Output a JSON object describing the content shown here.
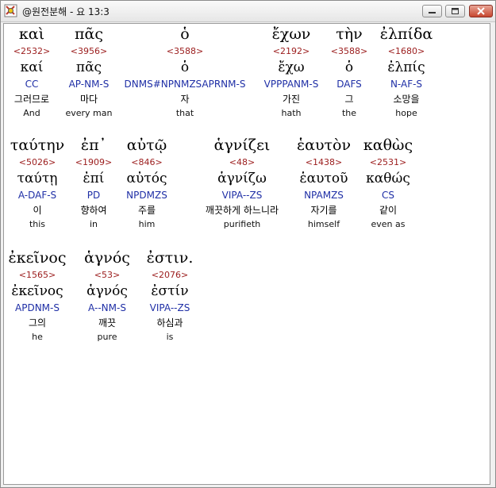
{
  "window": {
    "title": "@원전분해 - 요 13:3"
  },
  "rows": [
    {
      "words": [
        {
          "greek": "καὶ",
          "strong": "<2532>",
          "lemma": "καί",
          "parse": "CC",
          "korean": "그러므로",
          "english": "And"
        },
        {
          "greek": "πᾶς",
          "strong": "<3956>",
          "lemma": "πᾶς",
          "parse": "AP-NM-S",
          "korean": "마다",
          "english": "every man"
        },
        {
          "greek": "ὁ",
          "strong": "<3588>",
          "lemma": "ὁ",
          "parse": "DNMS#NPNMZSAPRNM-S",
          "korean": "자",
          "english": "that"
        },
        {
          "greek": "ἔχων",
          "strong": "<2192>",
          "lemma": "ἔχω",
          "parse": "VPPPANM-S",
          "korean": "가진",
          "english": "hath"
        },
        {
          "greek": "τὴν",
          "strong": "<3588>",
          "lemma": "ὁ",
          "parse": "DAFS",
          "korean": "그",
          "english": "the"
        },
        {
          "greek": "ἐλπίδα",
          "strong": "<1680>",
          "lemma": "ἐλπίς",
          "parse": "N-AF-S",
          "korean": "소망을",
          "english": "hope"
        }
      ]
    },
    {
      "words": [
        {
          "greek": "ταύτην",
          "strong": "<5026>",
          "lemma": "ταύτῃ",
          "parse": "A-DAF-S",
          "korean": "이",
          "english": "this"
        },
        {
          "greek": "ἐπ᾽",
          "strong": "<1909>",
          "lemma": "ἐπί",
          "parse": "PD",
          "korean": "향하여",
          "english": "in"
        },
        {
          "greek": "αὐτῷ",
          "strong": "<846>",
          "lemma": "αὐτός",
          "parse": "NPDMZS",
          "korean": "주를",
          "english": "him"
        },
        {
          "greek": "ἁγνίζει",
          "strong": "<48>",
          "lemma": "ἁγνίζω",
          "parse": "VIPA--ZS",
          "korean": "깨끗하게 하느니라",
          "english": "purifieth"
        },
        {
          "greek": "ἑαυτὸν",
          "strong": "<1438>",
          "lemma": "ἑαυτοῦ",
          "parse": "NPAMZS",
          "korean": "자기를",
          "english": "himself"
        },
        {
          "greek": "καθὼς",
          "strong": "<2531>",
          "lemma": "καθώς",
          "parse": "CS",
          "korean": "같이",
          "english": "even as"
        }
      ]
    },
    {
      "words": [
        {
          "greek": "ἐκεῖνος",
          "strong": "<1565>",
          "lemma": "ἐκεῖνος",
          "parse": "APDNM-S",
          "korean": "그의",
          "english": "he"
        },
        {
          "greek": "ἁγνός",
          "strong": "<53>",
          "lemma": "ἁγνός",
          "parse": "A--NM-S",
          "korean": "깨끗",
          "english": "pure"
        },
        {
          "greek": "ἐστιν.",
          "strong": "<2076>",
          "lemma": "ἐστίν",
          "parse": "VIPA--ZS",
          "korean": "하심과",
          "english": "is"
        }
      ]
    }
  ]
}
